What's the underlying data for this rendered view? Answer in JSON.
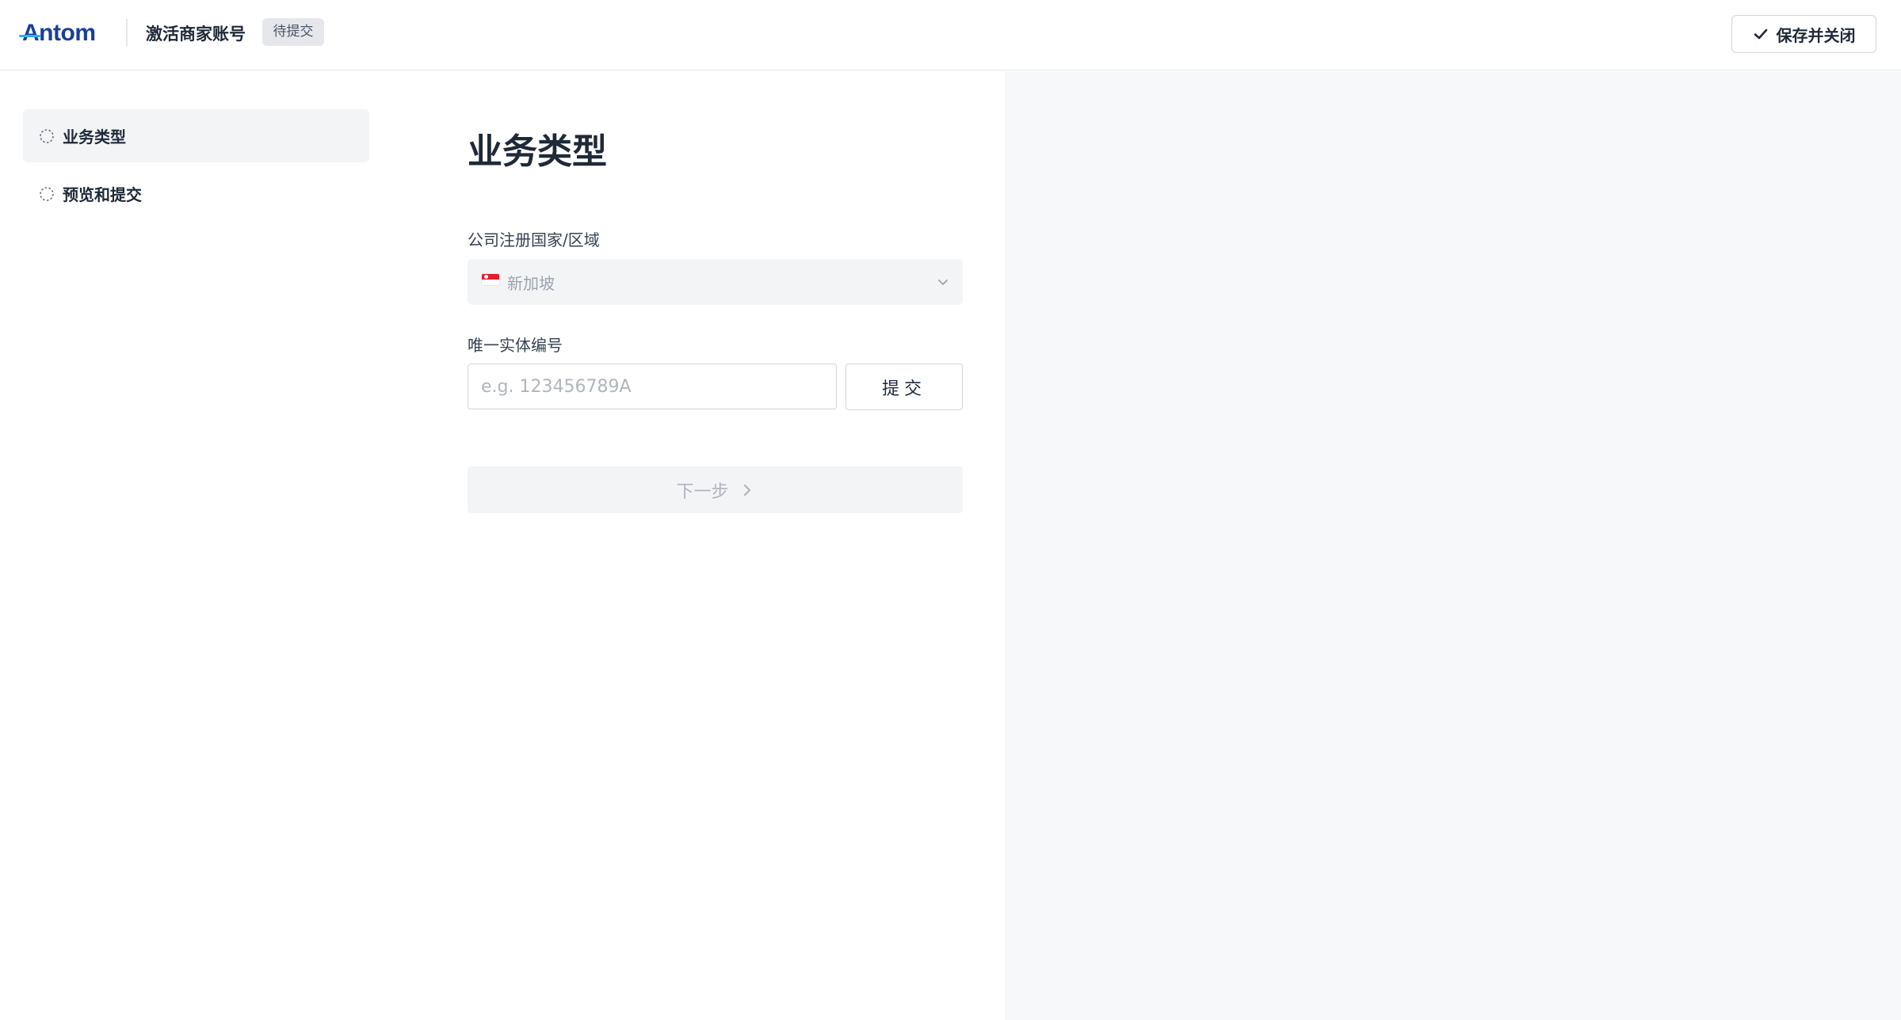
{
  "header": {
    "logo_first": "A",
    "logo_rest": "ntom",
    "title": "激活商家账号",
    "status_badge": "待提交",
    "save_close_label": "保存并关闭"
  },
  "sidebar": {
    "items": [
      {
        "label": "业务类型",
        "active": true,
        "icon": "dashed-circle-icon"
      },
      {
        "label": "预览和提交",
        "active": false,
        "icon": "dashed-circle-icon"
      }
    ]
  },
  "main": {
    "title": "业务类型",
    "country_field": {
      "label": "公司注册国家/区域",
      "value": "新加坡",
      "flag": "singapore-flag-icon"
    },
    "entity_field": {
      "label": "唯一实体编号",
      "placeholder": "e.g. 123456789A",
      "value": ""
    },
    "submit_label": "提交",
    "next_label": "下一步"
  },
  "colors": {
    "brand": "#1a3e9e",
    "brand_accent": "#2ab2f2",
    "right_pane_bg": "#f7f8fa",
    "disabled_bg": "#f3f4f6"
  }
}
